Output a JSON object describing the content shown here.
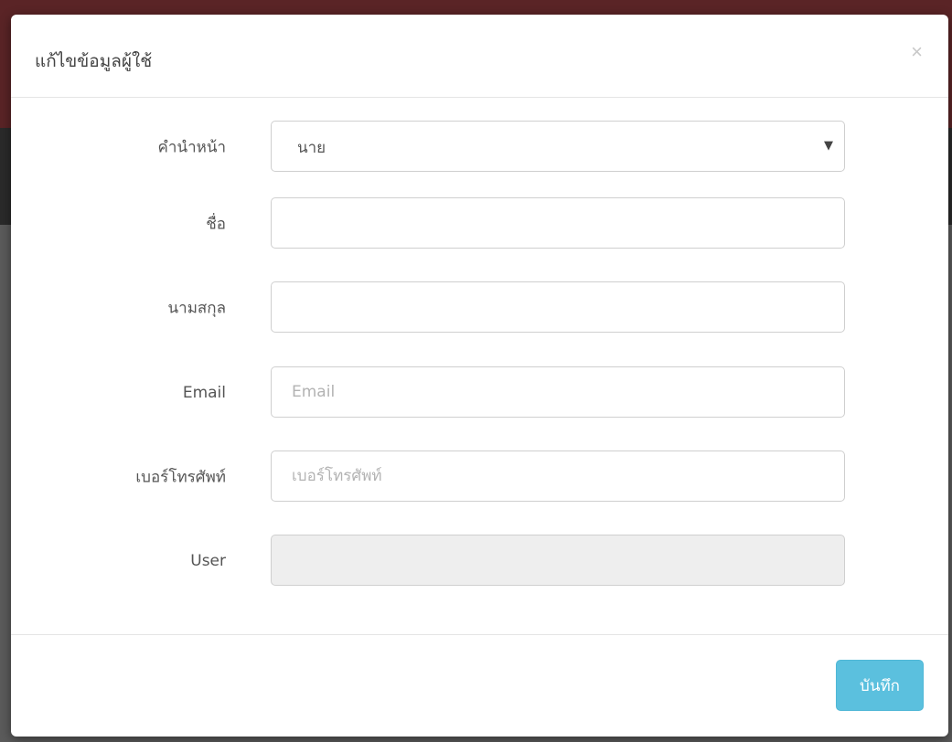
{
  "modal": {
    "title": "แก้ไขข้อมูลผู้ใช้",
    "close_symbol": "×"
  },
  "form": {
    "title_prefix": {
      "label": "คำนำหน้า",
      "selected": "นาย"
    },
    "first_name": {
      "label": "ชื่อ",
      "value": ""
    },
    "last_name": {
      "label": "นามสกุล",
      "value": ""
    },
    "email": {
      "label": "Email",
      "placeholder": "Email",
      "value": ""
    },
    "phone": {
      "label": "เบอร์โทรศัพท์",
      "placeholder": "เบอร์โทรศัพท์",
      "value": ""
    },
    "user": {
      "label": "User",
      "value": ""
    }
  },
  "footer": {
    "save_label": "บันทึก"
  },
  "colors": {
    "primary_button": "#5bc0de",
    "disabled_field": "#eeeeee",
    "backdrop_brand": "#5a2426"
  },
  "icons": {
    "close": "close-icon",
    "select_caret": "caret-down-icon"
  }
}
